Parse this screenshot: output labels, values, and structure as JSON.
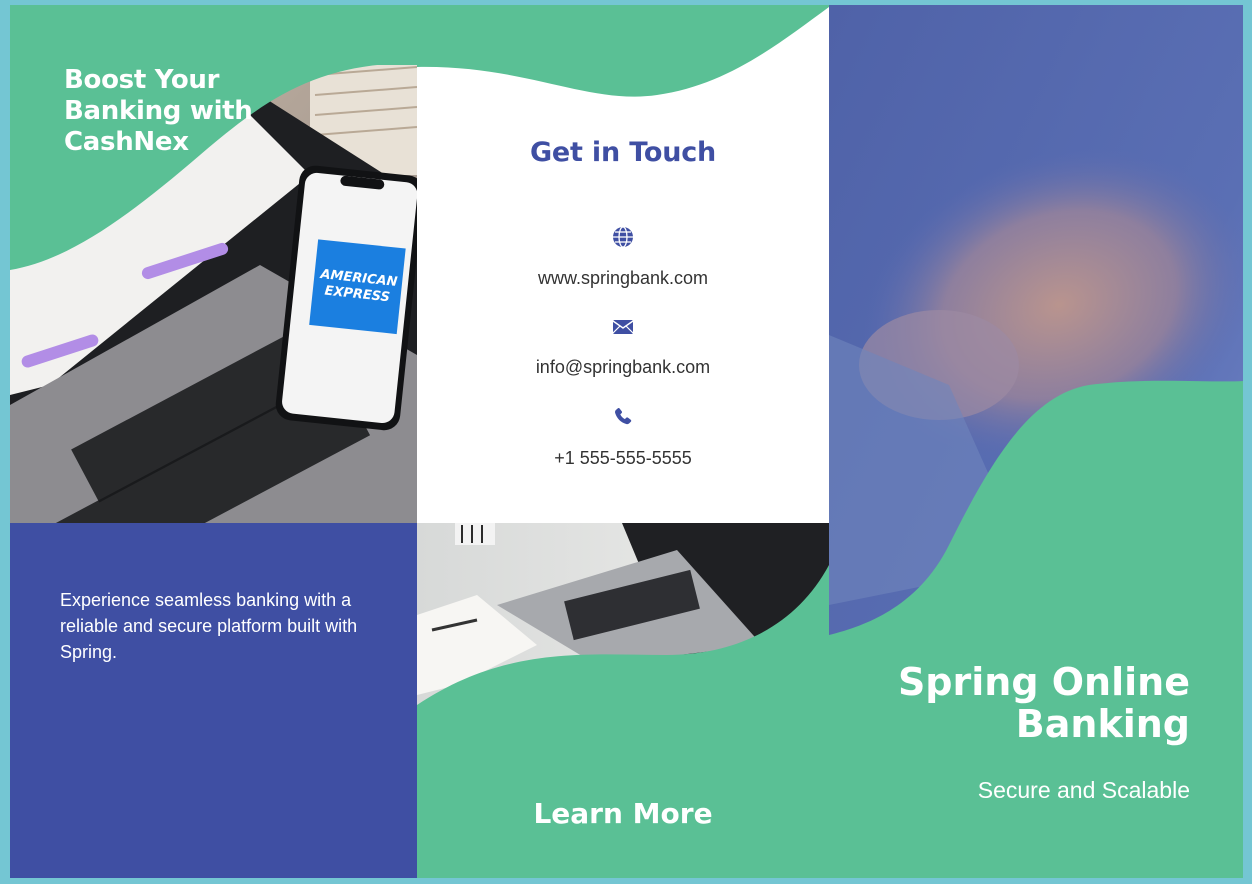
{
  "left_panel": {
    "headline_lines": [
      "Boost Your",
      "Banking with",
      "CashNex"
    ],
    "description": "Experience seamless banking with a reliable and secure platform built with Spring.",
    "phone_logo_lines": [
      "AMERICAN",
      "EXPRESS"
    ]
  },
  "middle_panel": {
    "title": "Get in Touch",
    "contacts": [
      {
        "icon": "globe-icon",
        "text": "www.springbank.com"
      },
      {
        "icon": "envelope-icon",
        "text": "info@springbank.com"
      },
      {
        "icon": "phone-icon",
        "text": "+1 555-555-5555"
      }
    ],
    "cta": "Learn More"
  },
  "right_panel": {
    "title_lines": [
      "Spring Online",
      "Banking"
    ],
    "subtitle": "Secure and Scalable"
  },
  "colors": {
    "green": "#5ac095",
    "navy": "#3f4fa3",
    "frame": "#74c6d3",
    "amex_blue": "#1b7fe0"
  }
}
